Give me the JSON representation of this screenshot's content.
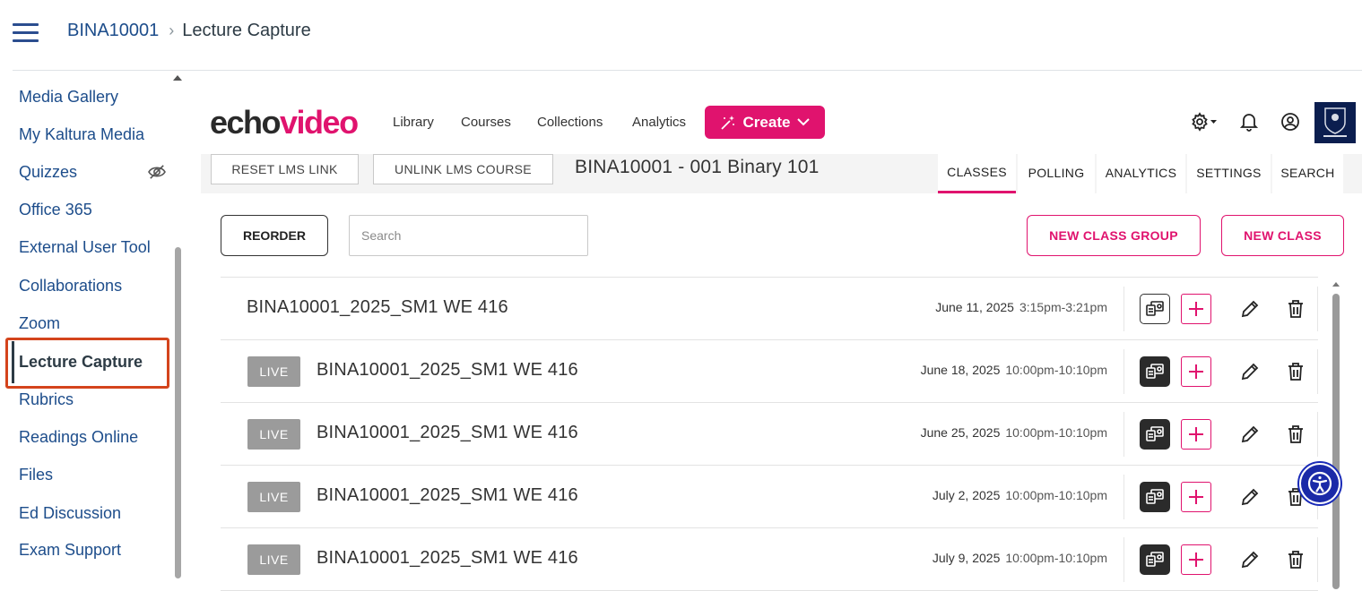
{
  "breadcrumb": {
    "course": "BINA10001",
    "separator": "›",
    "current": "Lecture Capture"
  },
  "course_nav": {
    "items": [
      {
        "label": "Media Gallery"
      },
      {
        "label": "My Kaltura Media"
      },
      {
        "label": "Quizzes"
      },
      {
        "label": "Office 365"
      },
      {
        "label": "External User Tool"
      },
      {
        "label": "Collaborations"
      },
      {
        "label": "Zoom"
      },
      {
        "label": "Lecture Capture"
      },
      {
        "label": "Rubrics"
      },
      {
        "label": "Readings Online"
      },
      {
        "label": "Files"
      },
      {
        "label": "Ed Discussion"
      },
      {
        "label": "Exam Support"
      }
    ],
    "active_index": 7,
    "hidden_item_icon": "eye-slash-icon"
  },
  "echo": {
    "logo": {
      "part1": "echo",
      "part2": "video"
    },
    "nav": {
      "library": "Library",
      "courses": "Courses",
      "collections": "Collections",
      "analytics": "Analytics"
    },
    "create_label": "Create",
    "subbar": {
      "reset_lms": "RESET LMS LINK",
      "unlink_lms": "UNLINK LMS COURSE",
      "course_title": "BINA10001 - 001 Binary 101",
      "tabs": {
        "classes": "CLASSES",
        "polling": "POLLING",
        "analytics": "ANALYTICS",
        "settings": "SETTINGS",
        "search": "SEARCH"
      },
      "active_tab": "CLASSES"
    },
    "toolbar": {
      "reorder": "REORDER",
      "search_placeholder": "Search",
      "new_class_group": "NEW CLASS GROUP",
      "new_class": "NEW CLASS"
    },
    "live_label": "LIVE",
    "classes": [
      {
        "name": "BINA10001_2025_SM1 WE 416",
        "date": "June 11, 2025",
        "time": "3:15pm-3:21pm",
        "live": false
      },
      {
        "name": "BINA10001_2025_SM1 WE 416",
        "date": "June 18, 2025",
        "time": "10:00pm-10:10pm",
        "live": true
      },
      {
        "name": "BINA10001_2025_SM1 WE 416",
        "date": "June 25, 2025",
        "time": "10:00pm-10:10pm",
        "live": true
      },
      {
        "name": "BINA10001_2025_SM1 WE 416",
        "date": "July 2, 2025",
        "time": "10:00pm-10:10pm",
        "live": true
      },
      {
        "name": "BINA10001_2025_SM1 WE 416",
        "date": "July 9, 2025",
        "time": "10:00pm-10:10pm",
        "live": true
      }
    ]
  },
  "colors": {
    "accent": "#e0136e",
    "canvas_link": "#1d4d8b",
    "active_outline": "#d4441c",
    "a11y": "#1b2aa8"
  }
}
